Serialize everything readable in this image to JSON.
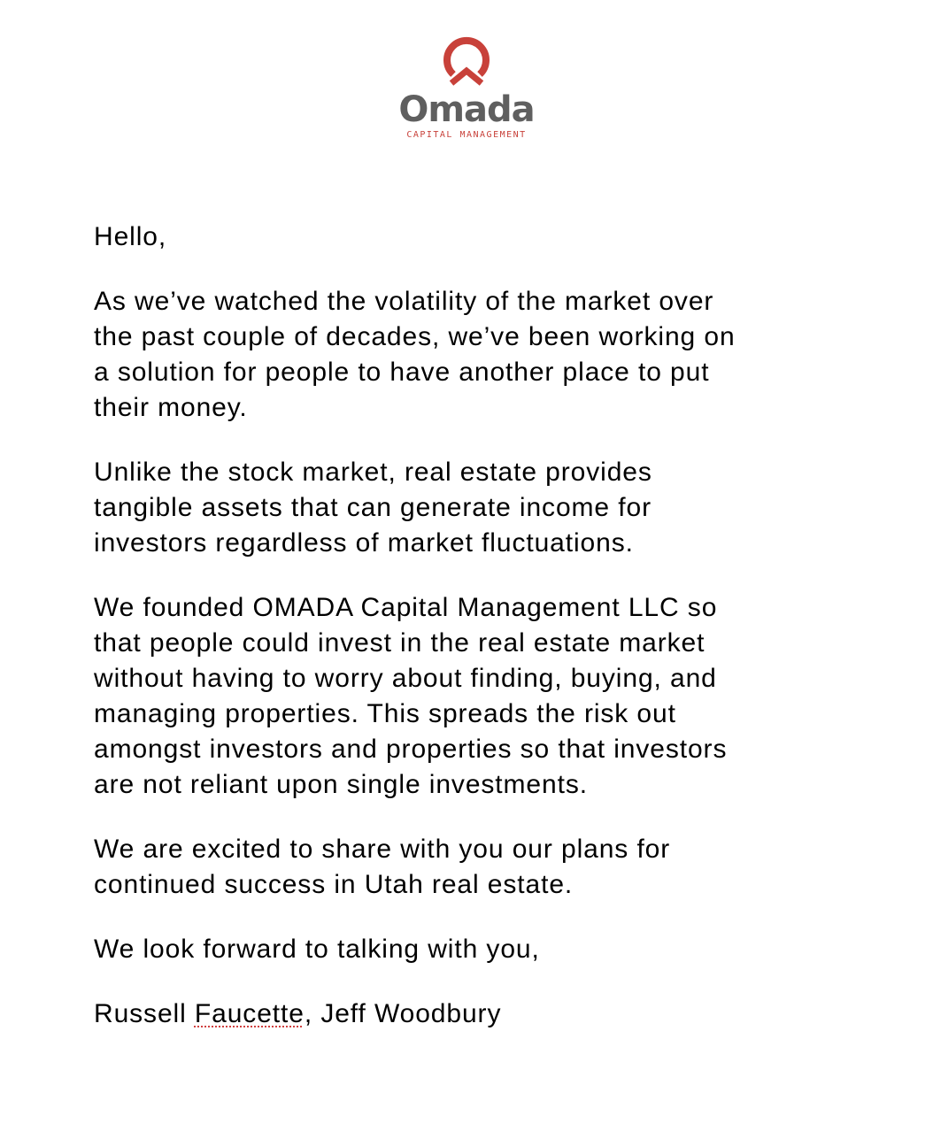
{
  "logo": {
    "wordmark": "Omada",
    "tagline": "CAPITAL MANAGEMENT",
    "mark_icon": "omada-roof-ring-icon",
    "accent_color": "#c8413a",
    "text_color": "#5f5f5f"
  },
  "letter": {
    "greeting": "Hello,",
    "paragraphs": [
      "As we’ve watched the volatility of the market over\nthe past couple of decades, we’ve been working on\na solution for people to have another place to put\ntheir money.",
      "Unlike the stock market, real estate provides\ntangible assets that can generate income for\ninvestors regardless of market fluctuations.",
      "We founded OMADA Capital Management LLC so\nthat people could invest in the real estate market\nwithout having to worry about finding, buying, and\nmanaging properties.  This spreads the risk out\namongst investors and properties so that investors\nare not reliant upon single investments.",
      "We are excited to share with you our plans for\ncontinued success in Utah real estate."
    ],
    "closing": "We look forward to talking with you,",
    "signature": {
      "first_prefix": "Russell ",
      "misspelled": "Faucette",
      "rest": ", Jeff Woodbury"
    }
  }
}
